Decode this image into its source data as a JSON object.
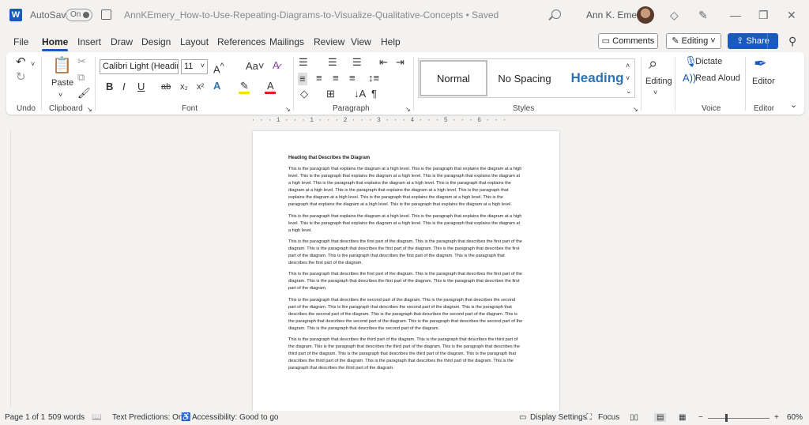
{
  "titlebar": {
    "autosave_label": "AutoSave",
    "autosave_state": "On",
    "document_title": "AnnKEmery_How-to-Use-Repeating-Diagrams-to-Visualize-Qualitative-Concepts • Saved",
    "user_name": "Ann K. Emery"
  },
  "menu": {
    "tabs": [
      "File",
      "Home",
      "Insert",
      "Draw",
      "Design",
      "Layout",
      "References",
      "Mailings",
      "Review",
      "View",
      "Help"
    ],
    "active_tab": "Home",
    "comments_label": "Comments",
    "editing_label": "Editing",
    "share_label": "Share"
  },
  "ribbon": {
    "undo_label": "Undo",
    "paste_label": "Paste",
    "clipboard_label": "Clipboard",
    "font_name": "Calibri Light (Heading",
    "font_size": "11",
    "font_label": "Font",
    "paragraph_label": "Paragraph",
    "styles": [
      "Normal",
      "No Spacing",
      "Heading"
    ],
    "styles_label": "Styles",
    "editing_label": "Editing",
    "dictate_label": "Dictate",
    "read_aloud_label": "Read Aloud",
    "voice_label": "Voice",
    "editor_label": "Editor",
    "editor_group_label": "Editor",
    "bold": "B",
    "italic": "I",
    "underline": "U",
    "strike": "ab",
    "subscript": "x₂",
    "superscript": "x²",
    "change_case": "Aa",
    "font_color": "A"
  },
  "ruler": {
    "text": "· · · 1 · · · 1 · · · 2 · · · 3 · · · 4 · · · 5 · · · 6 · · ·"
  },
  "document": {
    "heading": "Heading that Describes the Diagram",
    "paragraphs": [
      "This is the paragraph that explains the diagram at a high level. This is the paragraph that explains the diagram at a high level. This is the paragraph that explains the diagram at a high level. This is the paragraph that explains the diagram at a high level. This is the paragraph that explains the diagram at a high level. This is the paragraph that explains the diagram at a high level. This is the paragraph that explains the diagram at a high level. This is the paragraph that explains the diagram at a high level. This is the paragraph that explains the diagram at a high level. This is the paragraph that explains the diagram at a high level. This is the paragraph that explains the diagram at a high level.",
      "This is the paragraph that explains the diagram at a high level. This is the paragraph that explains the diagram at a high level. This is the paragraph that explains the diagram at a high level. This is the paragraph that explains the diagram at a high level.",
      "This is the paragraph that describes the first part of the diagram. This is the paragraph that describes the first part of the diagram. This is the paragraph that describes the first part of the diagram. This is the paragraph that describes the first part of the diagram. This is the paragraph that describes the first part of the diagram. This is the paragraph that describes the first part of the diagram.",
      "This is the paragraph that describes the first part of the diagram. This is the paragraph that describes the first part of the diagram. This is the paragraph that describes the first part of the diagram. This is the paragraph that describes the first part of the diagram.",
      "This is the paragraph that describes the second part of the diagram. This is the paragraph that describes the second part of the diagram. This is the paragraph that describes the second part of the diagram. This is the paragraph that describes the second part of the diagram. This is the paragraph that describes the second part of the diagram. This is the paragraph that describes the second part of the diagram. This is the paragraph that describes the second part of the diagram. This is the paragraph that describes the second part of the diagram.",
      "This is the paragraph that describes the third part of the diagram. This is the paragraph that describes the third part of the diagram. This is the paragraph that describes the third part of the diagram. This is the paragraph that describes the third part of the diagram. This is the paragraph that describes the third part of the diagram. This is the paragraph that describes the third part of the diagram. This is the paragraph that describes the third part of the diagram. This is the paragraph that describes the third part of the diagram."
    ]
  },
  "statusbar": {
    "page": "Page 1 of 1",
    "words": "509 words",
    "predictions": "Text Predictions: On",
    "accessibility": "Accessibility: Good to go",
    "display_settings": "Display Settings",
    "focus": "Focus",
    "zoom": "60%",
    "zoom_minus": "−",
    "zoom_plus": "+"
  },
  "colors": {
    "brand_blue": "#185abd",
    "heading_blue": "#2e74b5"
  }
}
